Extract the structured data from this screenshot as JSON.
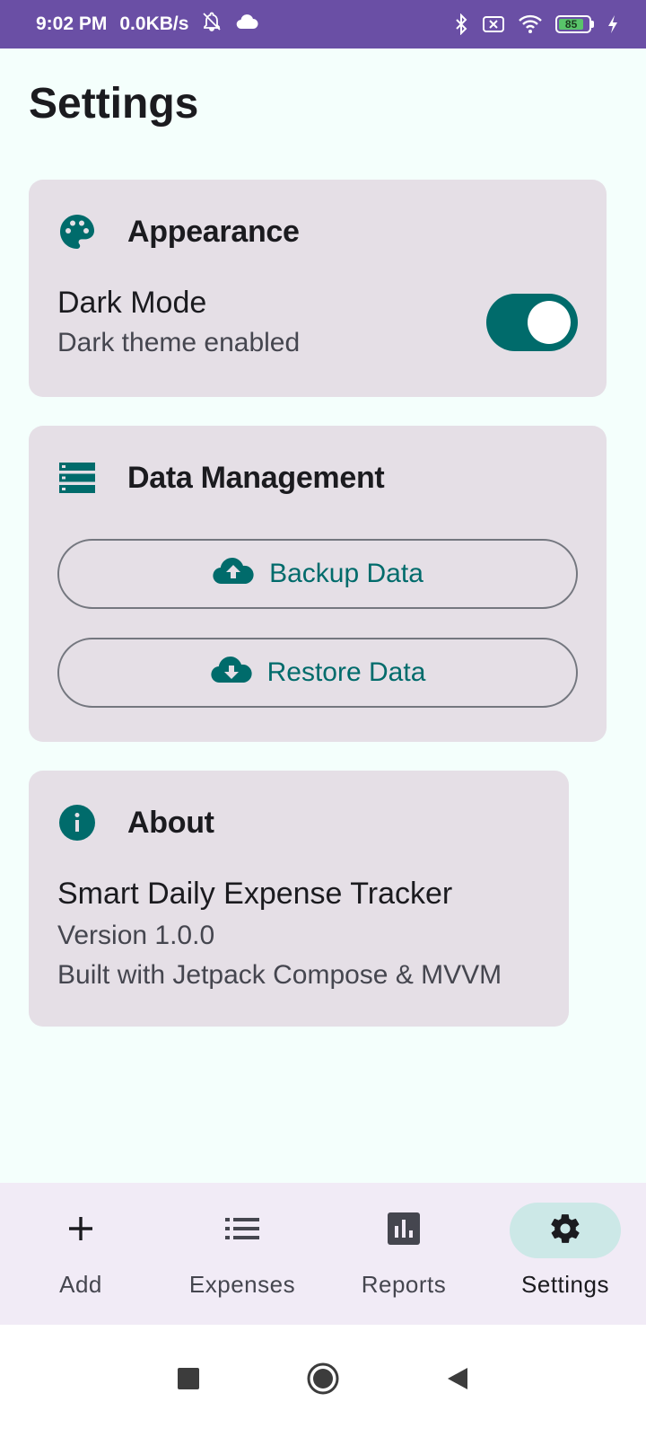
{
  "status_bar": {
    "time": "9:02 PM",
    "network_speed": "0.0KB/s",
    "battery_level": "85",
    "icons": [
      "notifications-off-icon",
      "cloud-icon",
      "bluetooth-icon",
      "sim-off-icon",
      "wifi-icon",
      "battery-icon",
      "charging-icon"
    ]
  },
  "page": {
    "title": "Settings"
  },
  "appearance": {
    "icon": "palette-icon",
    "title": "Appearance",
    "dark_mode_label": "Dark Mode",
    "dark_mode_status": "Dark theme enabled",
    "dark_mode_on": true
  },
  "data_management": {
    "icon": "storage-icon",
    "title": "Data Management",
    "backup_label": "Backup Data",
    "backup_icon": "cloud-upload-icon",
    "restore_label": "Restore Data",
    "restore_icon": "cloud-download-icon"
  },
  "about": {
    "icon": "info-icon",
    "title": "About",
    "app_name": "Smart Daily Expense Tracker",
    "version": "Version 1.0.0",
    "built_with": "Built with Jetpack Compose & MVVM"
  },
  "bottom_nav": {
    "items": [
      {
        "label": "Add",
        "icon": "add-icon"
      },
      {
        "label": "Expenses",
        "icon": "list-icon"
      },
      {
        "label": "Reports",
        "icon": "bar-chart-icon"
      },
      {
        "label": "Settings",
        "icon": "gear-icon",
        "active": true
      }
    ]
  },
  "colors": {
    "accent": "#006B6B",
    "status_bar": "#6A4FA5",
    "card": "#E5DFE6",
    "background": "#F4FFFC",
    "nav_active": "#CCE8E7"
  }
}
